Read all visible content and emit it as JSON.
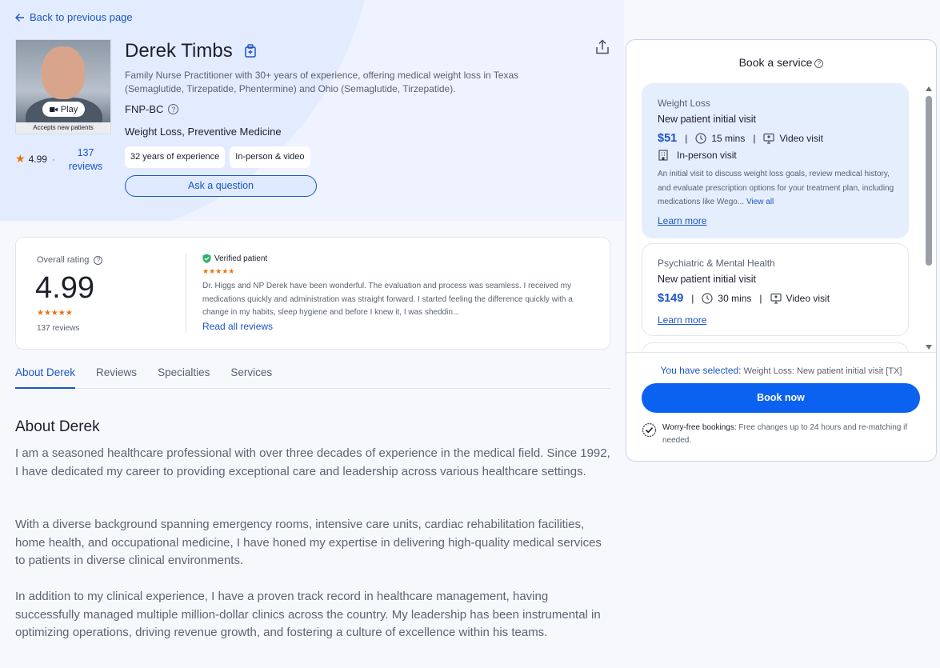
{
  "nav": {
    "back_label": "Back to previous page"
  },
  "provider": {
    "name": "Derek Timbs",
    "bio": "Family Nurse Practitioner with 30+ years of experience, offering medical weight loss in Texas (Semaglutide, Tirzepatide, Phentermine) and Ohio (Semaglutide, Tirzepatide).",
    "credential": "FNP-BC",
    "specialties": "Weight Loss, Preventive Medicine",
    "chips": [
      "32 years of experience",
      "In-person & video"
    ],
    "ask_label": "Ask a question",
    "photo_play_label": "Play",
    "photo_badge": "Accepts new patients",
    "rating": "4.99",
    "rating_sep": "·",
    "reviews_link": "137 reviews"
  },
  "rating_card": {
    "label": "Overall rating",
    "score": "4.99",
    "stars": "★★★★★",
    "count": "137 reviews",
    "verified_label": "Verified patient",
    "verified_stars": "★★★★★",
    "quote": "Dr. Higgs and NP Derek have been wonderful.  The evaluation and process was seamless.  I received my medications quickly and administration was straight forward.  I started feeling the difference quickly with a change in my habits, sleep hygiene and before I knew it, I was sheddin...",
    "read_all": "Read all reviews"
  },
  "tabs": [
    "About Derek",
    "Reviews",
    "Specialties",
    "Services"
  ],
  "about": {
    "heading": "About Derek",
    "paragraphs": [
      "I am a seasoned healthcare professional with over three decades of experience in the medical field. Since 1992, I have dedicated my career to providing exceptional care and leadership across various healthcare settings.",
      "With a diverse background spanning emergency rooms, intensive care units, cardiac rehabilitation facilities, home health, and occupational medicine, I have honed my expertise in delivering high-quality medical services to patients in diverse clinical environments.",
      "In addition to my clinical experience, I have a proven track record in healthcare management, having successfully managed multiple million-dollar clinics across the country. My leadership has been instrumental in optimizing operations, driving revenue growth, and fostering a culture of excellence within his teams."
    ]
  },
  "booking": {
    "title": "Book a service",
    "services": [
      {
        "category": "Weight Loss",
        "type": "New patient initial visit",
        "price": "$51",
        "sep": "|",
        "duration": "15 mins",
        "video": "Video visit",
        "inperson": "In-person visit",
        "description": "An initial visit to discuss weight loss goals, review medical history, and evaluate prescription options for your treatment plan, including medications like Wego...",
        "view_all": "View all",
        "learn_more": "Learn more"
      },
      {
        "category": "Psychiatric & Mental Health",
        "type": "New patient initial visit",
        "price": "$149",
        "sep": "|",
        "duration": "30 mins",
        "video": "Video visit",
        "learn_more": "Learn more"
      }
    ],
    "selected_label": "You have selected:",
    "selected_value": "Weight Loss: New patient initial visit [TX]",
    "book_label": "Book now",
    "worry_label": "Worry-free bookings:",
    "worry_text": "Free changes up to 24 hours and re-matching if needed."
  },
  "colors": {
    "accent": "#1a56c4",
    "button": "#0b62f0",
    "star": "#e8720c",
    "hero": "#eef3ff"
  }
}
